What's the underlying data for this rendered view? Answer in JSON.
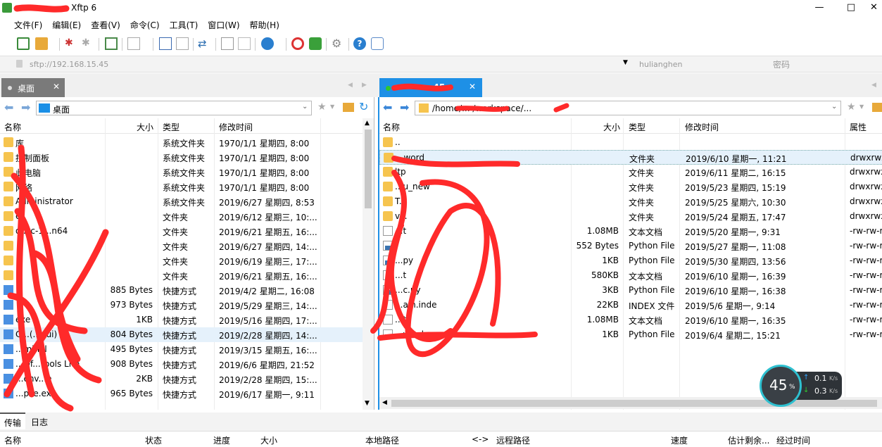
{
  "window": {
    "title": "- Xftp 6",
    "minimize": "—",
    "maximize": "□",
    "close": "✕"
  },
  "menu": [
    "文件(F)",
    "编辑(E)",
    "查看(V)",
    "命令(C)",
    "工具(T)",
    "窗口(W)",
    "帮助(H)"
  ],
  "address": {
    "host": "sftp://192.168.15.45",
    "user": "hulianghen",
    "password_placeholder": "密码"
  },
  "tabs": {
    "left": "桌面",
    "right": ".45"
  },
  "left_pane": {
    "path": "桌面",
    "headers": {
      "name": "名称",
      "size": "大小",
      "type": "类型",
      "modified": "修改时间"
    },
    "rows": [
      {
        "icon": "folder",
        "name": "库",
        "size": "",
        "type": "系统文件夹",
        "modified": "1970/1/1 星期四, 8:00"
      },
      {
        "icon": "folder",
        "name": "控制面板",
        "size": "",
        "type": "系统文件夹",
        "modified": "1970/1/1 星期四, 8:00"
      },
      {
        "icon": "folder",
        "name": "此电脑",
        "size": "",
        "type": "系统文件夹",
        "modified": "1970/1/1 星期四, 8:00"
      },
      {
        "icon": "folder",
        "name": "网络",
        "size": "",
        "type": "系统文件夹",
        "modified": "1970/1/1 星期四, 8:00"
      },
      {
        "icon": "folder",
        "name": "Administrator",
        "size": "",
        "type": "系统文件夹",
        "modified": "2019/6/27 星期四, 8:53"
      },
      {
        "icon": "folder",
        "name": "e",
        "size": "",
        "type": "文件夹",
        "modified": "2019/6/12 星期三, 10:..."
      },
      {
        "icon": "folder",
        "name": "o..cc-1...n64",
        "size": "",
        "type": "文件夹",
        "modified": "2019/6/21 星期五, 16:..."
      },
      {
        "icon": "folder",
        "name": "",
        "size": "",
        "type": "文件夹",
        "modified": "2019/6/27 星期四, 14:..."
      },
      {
        "icon": "folder",
        "name": "",
        "size": "",
        "type": "文件夹",
        "modified": "2019/6/19 星期三, 17:..."
      },
      {
        "icon": "folder",
        "name": "",
        "size": "",
        "type": "文件夹",
        "modified": "2019/6/21 星期五, 16:..."
      },
      {
        "icon": "link",
        "name": "",
        "size": "885 Bytes",
        "type": "快捷方式",
        "modified": "2019/4/2 星期二, 16:08"
      },
      {
        "icon": "link",
        "name": "",
        "size": "973 Bytes",
        "type": "快捷方式",
        "modified": "2019/5/29 星期三, 14:..."
      },
      {
        "icon": "link",
        "name": "exe",
        "size": "1KB",
        "type": "快捷方式",
        "modified": "2019/5/16 星期四, 17:..."
      },
      {
        "icon": "link",
        "name": "C...(...gui)",
        "size": "804 Bytes",
        "type": "快捷方式",
        "modified": "2019/2/28 星期四, 14:..."
      },
      {
        "icon": "link",
        "name": "...minal",
        "size": "495 Bytes",
        "type": "快捷方式",
        "modified": "2019/3/15 星期五, 16:..."
      },
      {
        "icon": "link",
        "name": "...Of...Tools Lite",
        "size": "908 Bytes",
        "type": "快捷方式",
        "modified": "2019/6/6 星期四, 21:52"
      },
      {
        "icon": "link",
        "name": "...env...e",
        "size": "2KB",
        "type": "快捷方式",
        "modified": "2019/2/28 星期四, 15:..."
      },
      {
        "icon": "link",
        "name": "...pse.exe",
        "size": "965 Bytes",
        "type": "快捷方式",
        "modified": "2019/6/17 星期一, 9:11"
      }
    ]
  },
  "right_pane": {
    "path": "/home/... /workspace/...",
    "headers": {
      "name": "名称",
      "size": "大小",
      "type": "类型",
      "modified": "修改时间",
      "attr": "属性"
    },
    "rows": [
      {
        "icon": "folder",
        "name": "..",
        "size": "",
        "type": "",
        "modified": "",
        "attr": ""
      },
      {
        "icon": "folder",
        "name": "...word",
        "size": "",
        "type": "文件夹",
        "modified": "2019/6/10 星期一, 11:21",
        "attr": "drwxrwx"
      },
      {
        "icon": "folder",
        "name": "ltp",
        "size": "",
        "type": "文件夹",
        "modified": "2019/6/11 星期二, 16:15",
        "attr": "drwxrwx"
      },
      {
        "icon": "folder",
        "name": "...u_new",
        "size": "",
        "type": "文件夹",
        "modified": "2019/5/23 星期四, 15:19",
        "attr": "drwxrwx"
      },
      {
        "icon": "folder",
        "name": "T...",
        "size": "",
        "type": "文件夹",
        "modified": "2019/5/25 星期六, 10:30",
        "attr": "drwxrwx"
      },
      {
        "icon": "folder",
        "name": "v...",
        "size": "",
        "type": "文件夹",
        "modified": "2019/5/24 星期五, 17:47",
        "attr": "drwxrwx"
      },
      {
        "icon": "doc",
        "name": "...t",
        "size": "1.08MB",
        "type": "文本文档",
        "modified": "2019/5/20 星期一, 9:31",
        "attr": "-rw-rw-r"
      },
      {
        "icon": "py",
        "name": "",
        "size": "552 Bytes",
        "type": "Python File",
        "modified": "2019/5/27 星期一, 11:08",
        "attr": "-rw-rw-r"
      },
      {
        "icon": "py",
        "name": "...py",
        "size": "1KB",
        "type": "Python File",
        "modified": "2019/5/30 星期四, 13:56",
        "attr": "-rw-rw-r"
      },
      {
        "icon": "doc",
        "name": "...t",
        "size": "580KB",
        "type": "文本文档",
        "modified": "2019/6/10 星期一, 16:39",
        "attr": "-rw-rw-r"
      },
      {
        "icon": "py",
        "name": "...c.py",
        "size": "3KB",
        "type": "Python File",
        "modified": "2019/6/10 星期一, 16:38",
        "attr": "-rw-rw-r"
      },
      {
        "icon": "doc",
        "name": "...ain.inde",
        "size": "22KB",
        "type": "INDEX 文件",
        "modified": "2019/5/6 星期一, 9:14",
        "attr": "-rw-rw-r"
      },
      {
        "icon": "doc",
        "name": "...t",
        "size": "1.08MB",
        "type": "文本文档",
        "modified": "2019/6/10 星期一, 16:35",
        "attr": "-rw-rw-r"
      },
      {
        "icon": "py",
        "name": "...word.py",
        "size": "1KB",
        "type": "Python File",
        "modified": "2019/6/4 星期二, 15:21",
        "attr": "-rw-rw-r"
      }
    ]
  },
  "speed": {
    "percent": "45",
    "unit": "%",
    "up": "0.1",
    "down": "0.3",
    "rate_unit": "K/s"
  },
  "bottom": {
    "tabs": [
      "传输",
      "日志"
    ],
    "headers": [
      "名称",
      "状态",
      "进度",
      "大小",
      "本地路径",
      "<->",
      "远程路径",
      "速度",
      "估计剩余...",
      "经过时间"
    ]
  }
}
